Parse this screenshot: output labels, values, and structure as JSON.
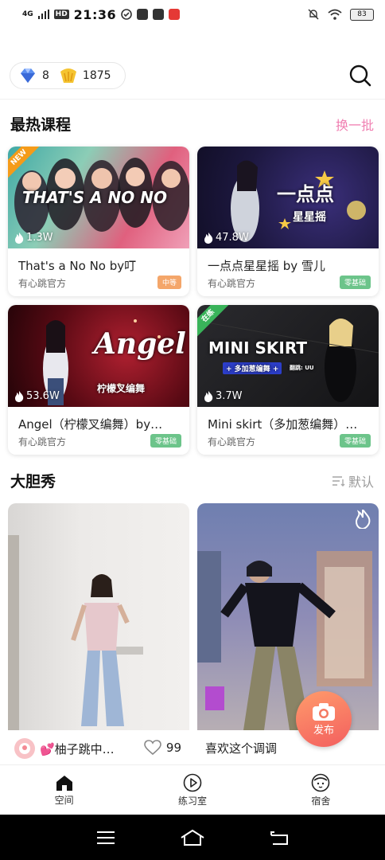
{
  "status_bar": {
    "network": "4G",
    "hd": "HD",
    "time": "21:36",
    "battery": "83"
  },
  "top": {
    "diamonds": "8",
    "coins": "1875"
  },
  "hot_courses": {
    "title": "最热课程",
    "action": "换一批",
    "cards": [
      {
        "title": "That's a No No by叮",
        "author": "有心跳官方",
        "views": "1.3W",
        "level": "中等",
        "ribbon": "NEW",
        "thumb_text": "THAT'S A NO NO"
      },
      {
        "title": "一点点星星摇 by 雪儿",
        "author": "有心跳官方",
        "views": "47.8W",
        "level": "零基础",
        "thumb_text": "一点点",
        "thumb_sub": "星星摇"
      },
      {
        "title": "Angel（柠檬叉编舞）by…",
        "author": "有心跳官方",
        "views": "53.6W",
        "level": "零基础",
        "thumb_text": "Angel",
        "thumb_sub": "柠檬叉编舞"
      },
      {
        "title": "Mini skirt（多加葱编舞）…",
        "author": "有心跳官方",
        "views": "3.7W",
        "level": "零基础",
        "ribbon": "在练",
        "thumb_text": "MINI SKIRT",
        "thumb_sub": "+ 多加葱编舞 +",
        "thumb_note": "翻跳: UU"
      }
    ]
  },
  "bold_show": {
    "title": "大胆秀",
    "sort": "默认",
    "posts": [
      {
        "user": "💕柚子跳中…",
        "likes": "99"
      },
      {
        "caption": "喜欢这个调调"
      }
    ],
    "publish": "发布"
  },
  "nav": {
    "items": [
      {
        "label": "空间",
        "icon": "home-icon"
      },
      {
        "label": "练习室",
        "icon": "play-circle-icon"
      },
      {
        "label": "宿舍",
        "icon": "face-icon"
      }
    ]
  }
}
